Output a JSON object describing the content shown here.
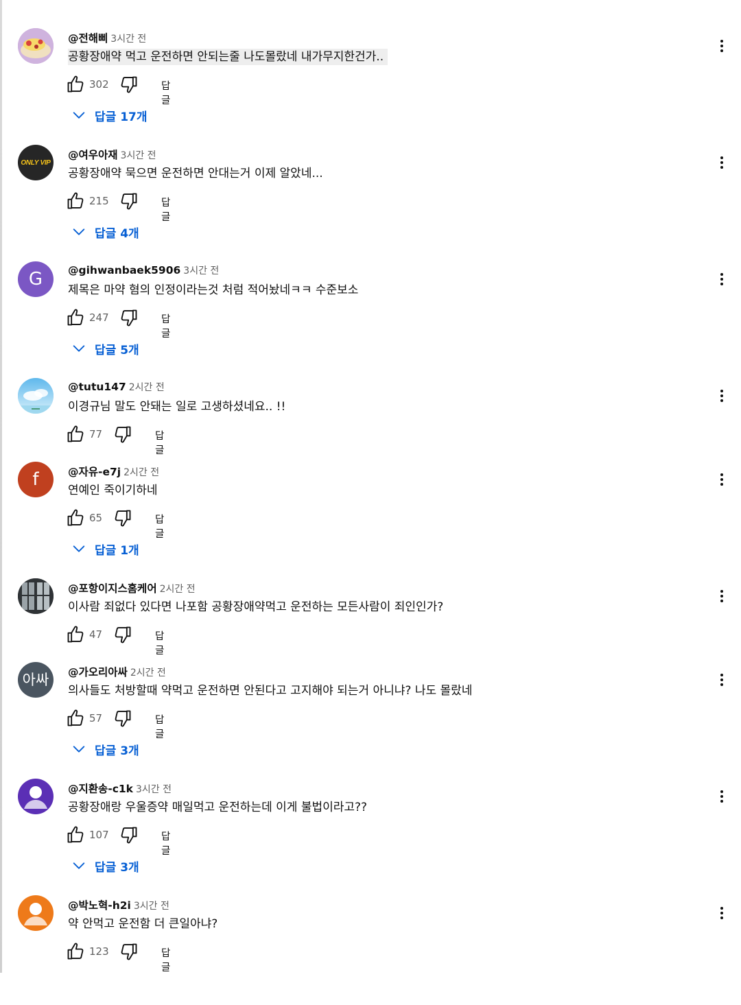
{
  "action_labels": {
    "reply": "답글"
  },
  "colors": {
    "link_blue": "#065fd4",
    "meta_gray": "#606060",
    "text": "#0f0f0f"
  },
  "comments": [
    {
      "author": "@전해삐",
      "time": "3시간 전",
      "text": "공황장애약 먹고 운전하면 안되는줄 나도몰랐네 내가무지한건가..",
      "likes": "302",
      "replies": "답글 17개",
      "avatar": {
        "type": "image",
        "desc": "dessert-photo"
      }
    },
    {
      "author": "@여우아재",
      "time": "3시간 전",
      "text": "공황장애약 묵으면 운전하면 안대는거 이제 알았네...",
      "likes": "215",
      "replies": "답글 4개",
      "avatar": {
        "type": "logo",
        "label": "ONLY VIP",
        "color": "#262626"
      }
    },
    {
      "author": "@gihwanbaek5906",
      "time": "3시간 전",
      "text": "제목은 마약 혐의 인정이라는것 처럼 적어놨네ㅋㅋ 수준보소",
      "likes": "247",
      "replies": "답글 5개",
      "avatar": {
        "type": "letter",
        "letter": "G",
        "color": "#7b57c4"
      }
    },
    {
      "author": "@tutu147",
      "time": "2시간 전",
      "text": "이경규님 말도 안돼는 일로 고생하셨네요.. !!",
      "likes": "77",
      "replies": null,
      "avatar": {
        "type": "image",
        "desc": "sky-photo"
      }
    },
    {
      "author": "@자유-e7j",
      "time": "2시간 전",
      "text": "연예인 죽이기하네",
      "likes": "65",
      "replies": "답글 1개",
      "avatar": {
        "type": "letter",
        "letter": "f",
        "color": "#c0401f"
      }
    },
    {
      "author": "@포항이지스홈케어",
      "time": "2시간 전",
      "text": "이사람 죄없다 있다면 나포함 공황장애약먹고 운전하는 모든사람이 죄인인가?",
      "likes": "47",
      "replies": null,
      "avatar": {
        "type": "image",
        "desc": "window-photo"
      }
    },
    {
      "author": "@가오리아싸",
      "time": "2시간 전",
      "text": "의사들도 처방할때 약먹고 운전하면 안된다고 고지해야 되는거 아니냐? 나도 몰랐네",
      "likes": "57",
      "replies": "답글 3개",
      "avatar": {
        "type": "letter",
        "letter": "아싸",
        "color": "#4a5560"
      }
    },
    {
      "author": "@지환송-c1k",
      "time": "3시간 전",
      "text": "공황장애랑 우울증약 매일먹고 운전하는데 이게 불법이라고??",
      "likes": "107",
      "replies": "답글 3개",
      "avatar": {
        "type": "person",
        "color": "#5b2fb5"
      }
    },
    {
      "author": "@박노혁-h2i",
      "time": "3시간 전",
      "text": "약 안먹고 운전함 더 큰일아냐?",
      "likes": "123",
      "replies": null,
      "avatar": {
        "type": "person",
        "color": "#ee7a1a"
      }
    }
  ]
}
